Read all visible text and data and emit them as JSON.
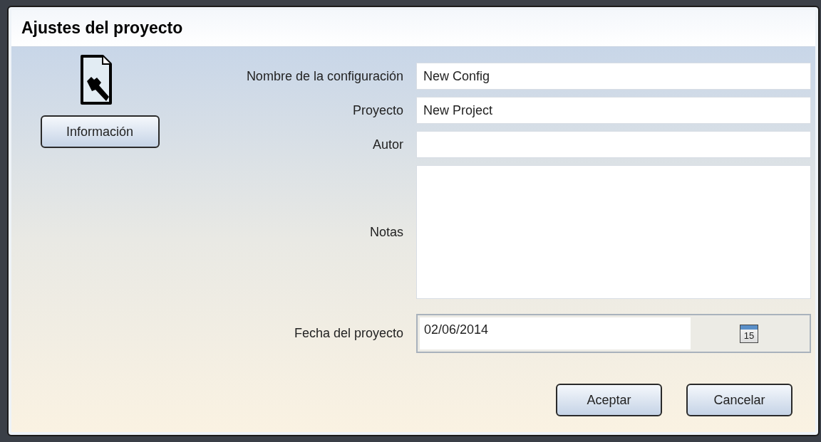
{
  "window": {
    "title": "Ajustes del proyecto"
  },
  "info_button": {
    "label": "Información"
  },
  "fields": [
    {
      "kind": "text",
      "label": "Nombre de la configuración",
      "value": "New Config"
    },
    {
      "kind": "text",
      "label": "Proyecto",
      "value": "New Project"
    },
    {
      "kind": "text",
      "label": "Autor"
    },
    {
      "kind": "textarea",
      "label": "Notas"
    },
    {
      "kind": "date",
      "label": "Fecha del proyecto",
      "value": "02/06/2014",
      "calendar_day": "15"
    }
  ],
  "buttons": [
    "Aceptar",
    "Cancelar"
  ]
}
